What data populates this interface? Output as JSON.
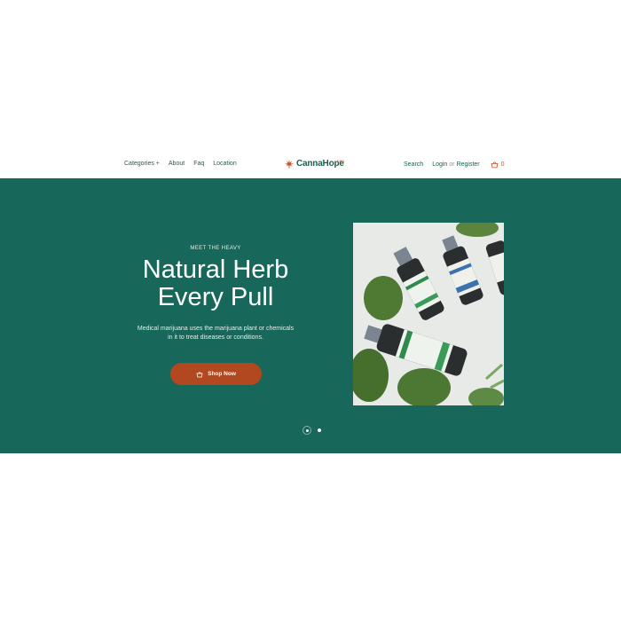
{
  "nav": {
    "categories": "Categories +",
    "about": "About",
    "faq": "Faq",
    "location": "Location"
  },
  "logo": {
    "text": "CannaHope",
    "sub": "CBD"
  },
  "account": {
    "search": "Search",
    "login": "Login",
    "or": "or",
    "register": "Register",
    "cart_count": "0"
  },
  "hero": {
    "eyebrow": "MEET THE HEAVY",
    "headline_line1": "Natural Herb",
    "headline_line2": "Every Pull",
    "description_line1": "Medical marijuana uses the marijuana plant or chemicals",
    "description_line2": "in it to treat diseases or conditions.",
    "cta": "Shop Now"
  },
  "slider": {
    "slides": 2,
    "active": 1
  },
  "colors": {
    "brand_green": "#17685a",
    "accent": "#b24820",
    "text_green": "#1d5e4f"
  },
  "icons": {
    "logo": "cannabis-leaf-icon",
    "cart": "basket-icon",
    "button": "basket-icon"
  }
}
